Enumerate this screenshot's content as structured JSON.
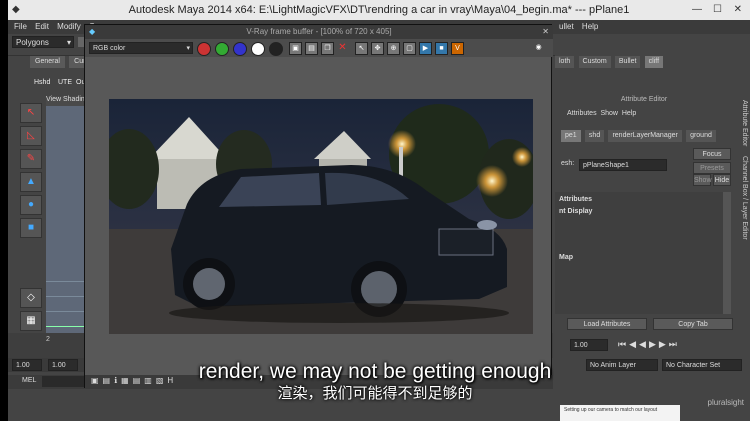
{
  "window": {
    "title": "Autodesk Maya 2014 x64: E:\\LightMagicVFX\\DT\\rendring a car in vray\\Maya\\04_begin.ma*   ---   pPlane1"
  },
  "menubar": {
    "items": [
      "File",
      "Edit",
      "Modify",
      "C"
    ],
    "right_items": [
      "ullet",
      "Help"
    ]
  },
  "statusline": {
    "mode_select": "Polygons"
  },
  "shelf": {
    "tabs": [
      "General",
      "Cur"
    ],
    "buttons": [
      "Hshd",
      "UTE",
      "Ou"
    ]
  },
  "viewport": {
    "menu": [
      "View",
      "Shading"
    ]
  },
  "right_panel": {
    "shelf_tabs": [
      "loth",
      "Custom",
      "Bullet",
      "cliff"
    ],
    "attr_editor_title": "Attribute Editor",
    "menu": [
      "Attributes",
      "Show",
      "Help"
    ],
    "node_tabs": [
      "pe1",
      "shd",
      "renderLayerManager",
      "ground"
    ],
    "mesh_label": "esh:",
    "mesh_value": "pPlaneShape1",
    "buttons": {
      "focus": "Focus",
      "presets": "Presets",
      "show": "Show",
      "hide": "Hide"
    },
    "sections": [
      "Attributes",
      "nt Display",
      "Map"
    ],
    "load_attributes": "Load Attributes",
    "copy_tab": "Copy Tab",
    "vertical_tabs": [
      "Attribute Editor",
      "Channel Box / Layer Editor"
    ]
  },
  "timeline": {
    "start": "1.00",
    "end": "1.00",
    "current": "1.00",
    "range_end": "1.00",
    "anim_layer": "No Anim Layer",
    "character_set": "No Character Set",
    "tick_2": "2"
  },
  "mel": {
    "label": "MEL"
  },
  "vfb": {
    "title": "V-Ray frame buffer - [100% of 720 x 405]",
    "channel_select": "RGB color"
  },
  "subtitle": {
    "english": "render, we may not be getting enough",
    "chinese": "渲染，我们可能得不到足够的"
  },
  "doc_snippet": {
    "lines": [
      "Setting up our camera to match our layout"
    ]
  },
  "watermark": "pluralsight",
  "colors": {
    "maya_bg": "#444444",
    "vfb_bg": "#585858",
    "render_bg": "#1c2230"
  }
}
